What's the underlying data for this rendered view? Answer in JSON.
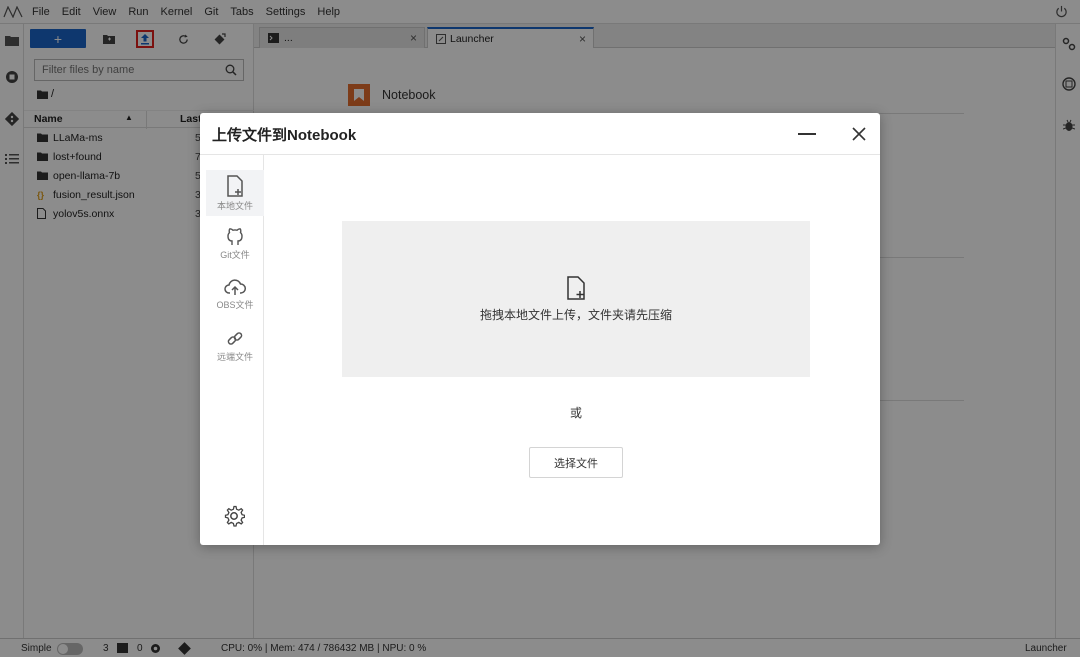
{
  "menubar": {
    "items": [
      "File",
      "Edit",
      "View",
      "Run",
      "Kernel",
      "Git",
      "Tabs",
      "Settings",
      "Help"
    ]
  },
  "filebrowser": {
    "new_label": "+",
    "filter_placeholder": "Filter files by name",
    "breadcrumb": "/",
    "columns": {
      "name": "Name",
      "last": "Last"
    },
    "files": [
      {
        "name": "LLaMa-ms",
        "type": "folder",
        "date": "5"
      },
      {
        "name": "lost+found",
        "type": "folder",
        "date": "7"
      },
      {
        "name": "open-llama-7b",
        "type": "folder",
        "date": "5"
      },
      {
        "name": "fusion_result.json",
        "type": "json",
        "date": "3"
      },
      {
        "name": "yolov5s.onnx",
        "type": "file",
        "date": "3"
      }
    ]
  },
  "tabs": [
    {
      "label": "...",
      "close": "×"
    },
    {
      "label": "Launcher",
      "close": "×"
    }
  ],
  "launcher": {
    "notebook_label": "Notebook"
  },
  "statusbar": {
    "mode": "Simple",
    "terminals": "3",
    "kernels": "0",
    "resources": "CPU: 0% | Mem: 474 / 786432 MB | NPU: 0 %",
    "right_label": "Launcher"
  },
  "modal": {
    "title": "上传文件到Notebook",
    "sources": [
      {
        "label": "本地文件",
        "icon": "file-add-icon"
      },
      {
        "label": "Git文件",
        "icon": "github-icon"
      },
      {
        "label": "OBS文件",
        "icon": "cloud-upload-icon"
      },
      {
        "label": "远端文件",
        "icon": "link-icon"
      }
    ],
    "drop_hint": "拖拽本地文件上传，文件夹请先压缩",
    "or_text": "或",
    "choose_button": "选择文件"
  },
  "colors": {
    "accent": "#1a64c8",
    "highlight": "#e0201d",
    "notebook": "#e46e2e"
  }
}
